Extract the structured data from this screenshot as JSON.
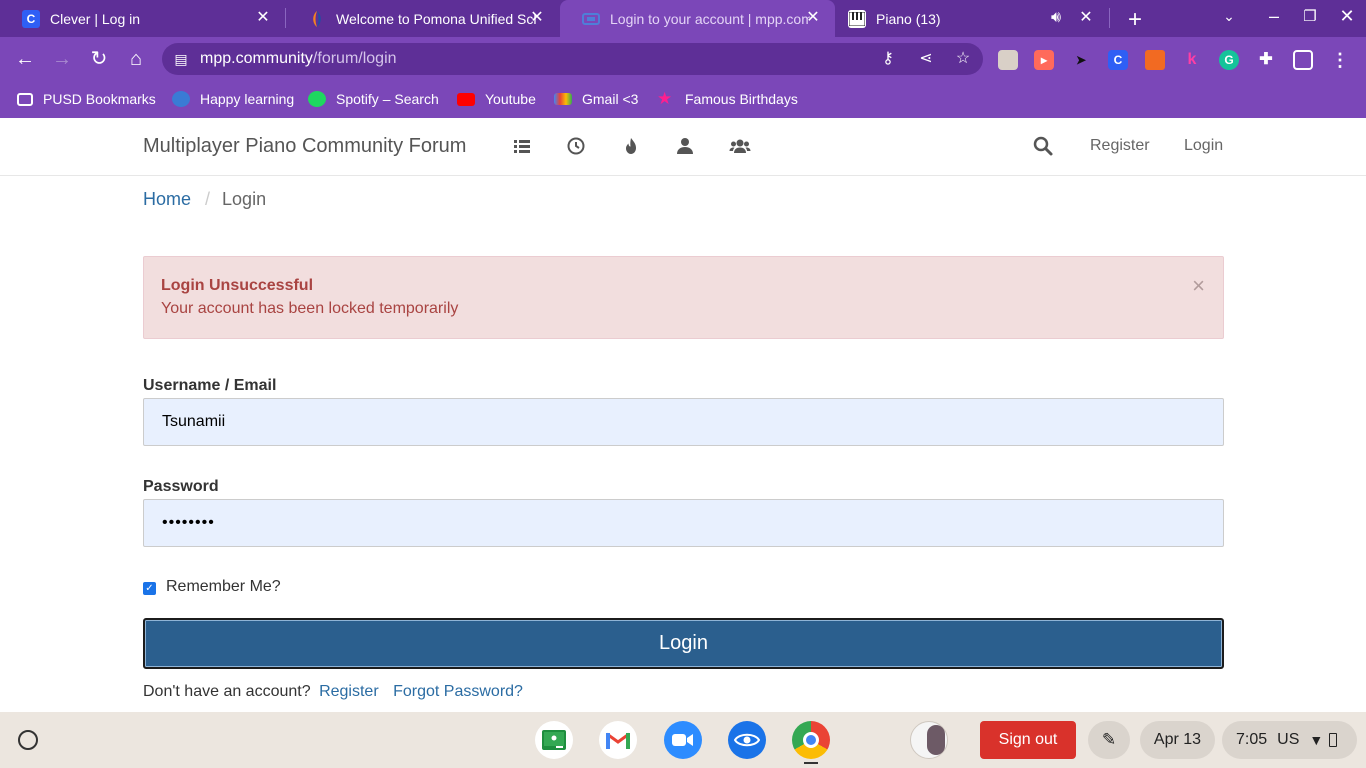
{
  "browser": {
    "tabs": [
      {
        "title": "Clever | Log in",
        "favicon": "clever-c-icon",
        "active": false
      },
      {
        "title": "Welcome to Pomona Unified Sch",
        "favicon": "pusd-icon",
        "active": false
      },
      {
        "title": "Login to your account | mpp.com",
        "favicon": "mpp-icon",
        "active": true
      },
      {
        "title": "Piano (13)",
        "favicon": "piano-icon",
        "active": false,
        "audio": true
      }
    ],
    "url_host": "mpp.community",
    "url_path": "/forum/login",
    "clever_ext_letter": "C",
    "k_ext_letter": "k"
  },
  "bookmarks": [
    {
      "label": "PUSD Bookmarks",
      "icon": "folder-icon"
    },
    {
      "label": "Happy learning",
      "icon": "happy-learning-icon"
    },
    {
      "label": "Spotify – Search",
      "icon": "spotify-icon"
    },
    {
      "label": "Youtube",
      "icon": "youtube-icon"
    },
    {
      "label": "Gmail <3",
      "icon": "gmail-icon"
    },
    {
      "label": "Famous Birthdays",
      "icon": "star-icon"
    }
  ],
  "navbar": {
    "brand": "Multiplayer Piano Community Forum",
    "icons": [
      "list-icon",
      "clock-icon",
      "fire-icon",
      "user-icon",
      "users-icon"
    ],
    "register": "Register",
    "login": "Login"
  },
  "breadcrumb": {
    "home": "Home",
    "separator": "/",
    "current": "Login"
  },
  "alert": {
    "heading": "Login Unsuccessful",
    "message": "Your account has been locked temporarily",
    "close": "×"
  },
  "form": {
    "username_label": "Username / Email",
    "username_value": "Tsunamii",
    "password_label": "Password",
    "password_value": "••••••••",
    "remember_label": "Remember Me?",
    "remember_checked": true,
    "submit": "Login",
    "no_account": "Don't have an account?",
    "register_link": "Register",
    "forgot_link": "Forgot Password?"
  },
  "shelf": {
    "apps": [
      "google-classroom-icon",
      "gmail-icon",
      "zoom-icon",
      "eye-app-icon",
      "chrome-icon"
    ],
    "signout": "Sign out",
    "date": "Apr 13",
    "time": "7:05",
    "locale": "US"
  },
  "colors": {
    "chrome_purple": "#7b47b8",
    "chrome_purple_dark": "#5e2f97",
    "link_blue": "#2b6ca3",
    "alert_bg": "#f2dede",
    "alert_text": "#a94442",
    "button_blue": "#2b5f8e",
    "signout_red": "#d9322b"
  }
}
